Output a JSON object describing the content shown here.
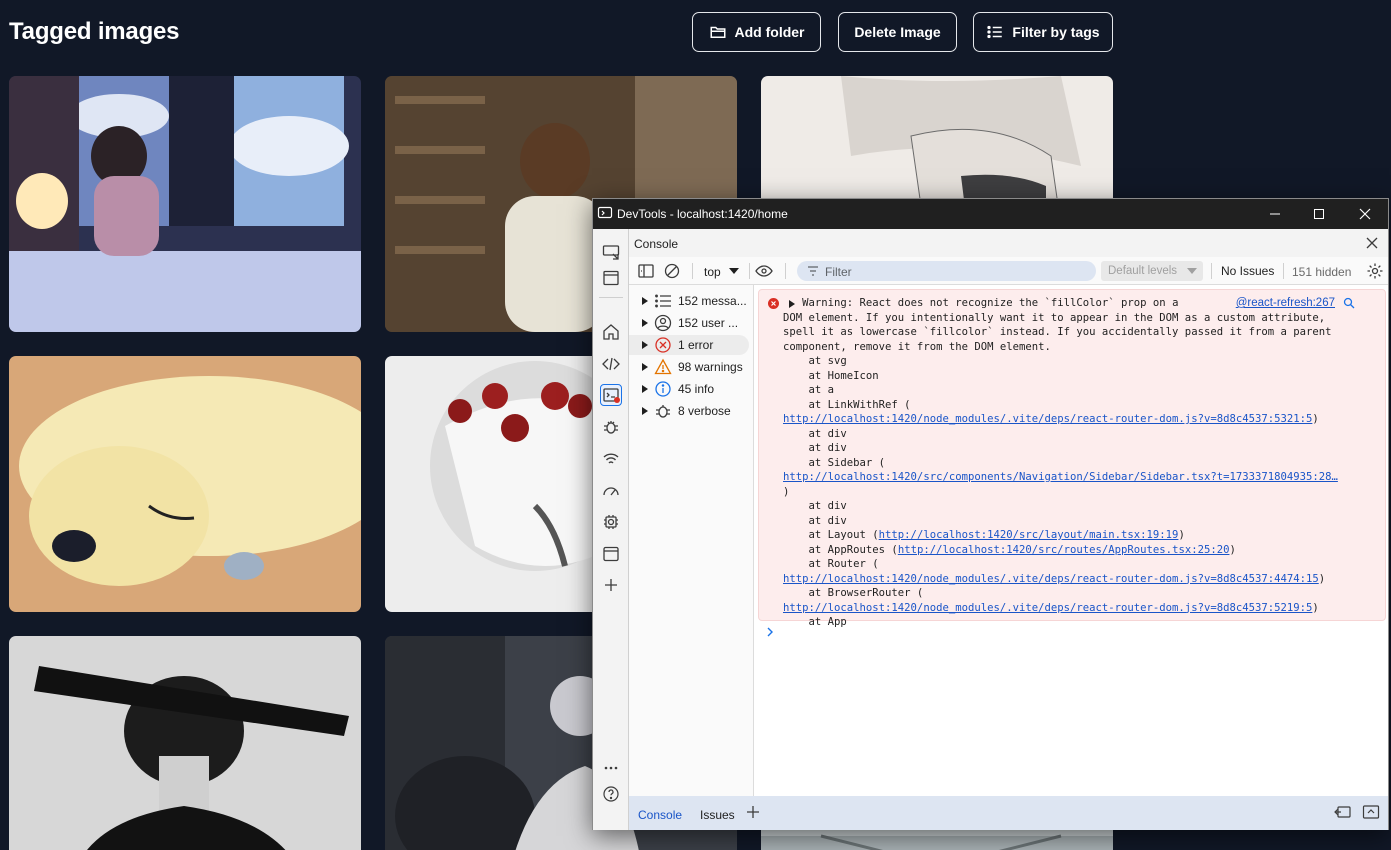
{
  "app": {
    "title": "Tagged images",
    "buttons": {
      "add_folder": "Add folder",
      "delete_image": "Delete Image",
      "filter_by_tags": "Filter by tags"
    }
  },
  "gallery": {
    "images": [
      {
        "subject": "anime boy with headphones by window"
      },
      {
        "subject": "anime boy in library"
      },
      {
        "subject": "sketch of person with mask"
      },
      {
        "subject": "sleeping cartoon dog"
      },
      {
        "subject": "girl with rose crown"
      },
      {
        "subject": "silhouette with brush stroke over eyes"
      },
      {
        "subject": "dark anime scene"
      }
    ]
  },
  "devtools": {
    "window_title": "DevTools - localhost:1420/home",
    "panel_title": "Console",
    "context": "top",
    "filter_placeholder": "Filter",
    "levels": "Default levels",
    "issues": "No Issues",
    "hidden": "151 hidden",
    "sidebar": [
      {
        "label": "152 messa...",
        "icon": "list-icon"
      },
      {
        "label": "152 user ...",
        "icon": "user-icon"
      },
      {
        "label": "1 error",
        "icon": "error-icon"
      },
      {
        "label": "98 warnings",
        "icon": "warning-icon"
      },
      {
        "label": "45 info",
        "icon": "info-icon"
      },
      {
        "label": "8 verbose",
        "icon": "bug-icon"
      }
    ],
    "message": {
      "source": "@react-refresh:267",
      "line1": "Warning: React does not recognize the `fillColor` prop on a",
      "line2": "DOM element. If you intentionally want it to appear in the DOM as a custom attribute,",
      "line3": "spell it as lowercase `fillcolor` instead. If you accidentally passed it from a parent",
      "line4": "component, remove it from the DOM element.",
      "stack": [
        "    at svg",
        "    at HomeIcon",
        "    at a",
        "    at LinkWithRef ("
      ],
      "link1": "http://localhost:1420/node_modules/.vite/deps/react-router-dom.js?v=8d8c4537:5321:5",
      "stack2": [
        "    at div",
        "    at div",
        "    at Sidebar ("
      ],
      "link2": "http://localhost:1420/src/components/Navigation/Sidebar/Sidebar.tsx?t=1733371804935:28…",
      "close_paren": ")",
      "stack3": [
        "    at div",
        "    at div"
      ],
      "layout_prefix": "    at Layout (",
      "layout_link": "http://localhost:1420/src/layout/main.tsx:19:19",
      "approutes_prefix": "    at AppRoutes (",
      "approutes_link": "http://localhost:1420/src/routes/AppRoutes.tsx:25:20",
      "router_line": "    at Router (",
      "link3": "http://localhost:1420/node_modules/.vite/deps/react-router-dom.js?v=8d8c4537:4474:15",
      "browser_line": "    at BrowserRouter (",
      "link4": "http://localhost:1420/node_modules/.vite/deps/react-router-dom.js?v=8d8c4537:5219:5",
      "app_line": "    at App"
    },
    "drawer": {
      "tab_console": "Console",
      "tab_issues": "Issues"
    }
  }
}
